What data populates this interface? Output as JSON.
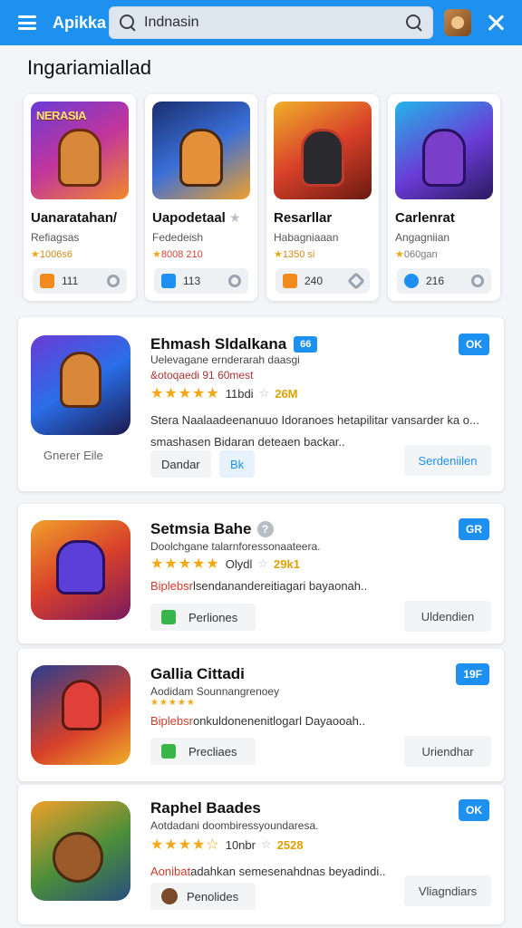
{
  "header": {
    "app_title": "Apikka",
    "search_value": "Indnasin",
    "accent": "#1e90f0"
  },
  "section": {
    "title": "Ingariamiallad"
  },
  "featured": [
    {
      "art_text": "NERASIA",
      "name": "Uanaratahan/",
      "sub": "Refiagsas",
      "meta": "1006s6",
      "count": "111"
    },
    {
      "art_text": "",
      "name": "Uapodetaal",
      "sub": "Fededeish",
      "meta": "8008 210",
      "count": "113"
    },
    {
      "art_text": "",
      "name": "Resarllar",
      "sub": "Habagniaaan",
      "meta": "1350 si",
      "count": "240"
    },
    {
      "art_text": "",
      "name": "Carlenrat",
      "sub": "Angagniian",
      "meta": "060gan",
      "count": "216"
    }
  ],
  "apps": [
    {
      "title": "Ehmash Sldalkana",
      "badge": "66",
      "tag": "OK",
      "sub1": "Uelevagane ernderarah daasgi",
      "sub2": "&otoqaedi 91 60mest",
      "rating_num": "11bdi",
      "rating_gold": "26M",
      "desc": "Stera Naalaadeenanuuo Idoranoes hetapilitar vansarder ka o... smashasen Bidaran deteaen backar..",
      "genre": "Gnerer Eile",
      "btn1": "Dandar",
      "btn2": "Bk",
      "btn_right": "Serdeniilen"
    },
    {
      "title": "Setmsia Bahe",
      "tag": "GR",
      "sub1": "Doolchgane talarnforessonaateera.",
      "rating_num": "Olydl",
      "rating_gold": "29k1",
      "desc_red": "Biplebsr",
      "desc": "lsendanandereitiagari bayaonah..",
      "btn1": "Perliones",
      "btn_right": "Uldendien"
    },
    {
      "title": "Gallia Cittadi",
      "tag": "19F",
      "sub1": "Aodidam Sounnangrenoey",
      "desc_red": "Biplebsr",
      "desc": "onkuldonenenitlogarl Dayaooah..",
      "btn1": "Precliaes",
      "btn_right": "Uriendhar"
    },
    {
      "title": "Raphel Baades",
      "tag": "OK",
      "sub1": "Aotdadani doombiressyoundaresa.",
      "rating_num": "10nbr",
      "rating_gold": "2528",
      "desc_red": "Aonibat",
      "desc": "adahkan semesenahdnas beyadindi..",
      "btn1": "Penolides",
      "btn_right": "Vliagndiars"
    }
  ]
}
